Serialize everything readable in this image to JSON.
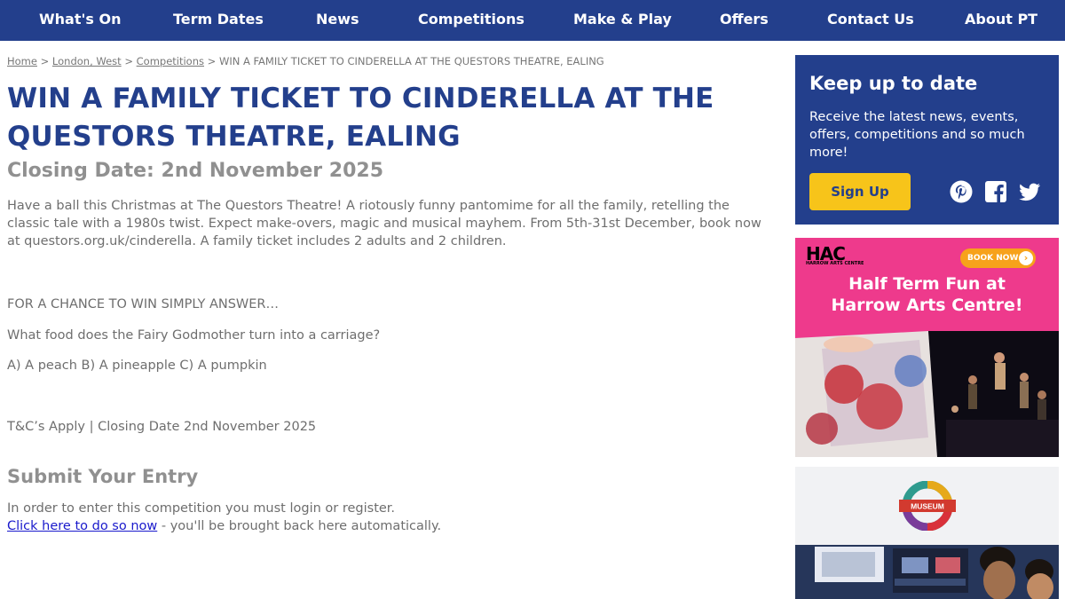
{
  "nav": {
    "items": [
      "What's On",
      "Term Dates",
      "News",
      "Competitions",
      "Make & Play",
      "Offers",
      "Contact Us",
      "About PT"
    ]
  },
  "breadcrumb": {
    "home": "Home",
    "sep1": " > ",
    "region": "London, West",
    "sep2": " > ",
    "section": "Competitions",
    "sep3": " > ",
    "current": "WIN A FAMILY TICKET TO CINDERELLA AT THE QUESTORS THEATRE, EALING"
  },
  "article": {
    "title_line1": "WIN A FAMILY TICKET TO CINDERELLA AT THE",
    "title_line2": "QUESTORS THEATRE, EALING",
    "closing_date": "Closing Date: 2nd November 2025",
    "description": "Have a ball this Christmas at The Questors Theatre! A riotously funny pantomime for all the family, retelling the classic tale with a 1980s twist. Expect make-overs, magic and musical mayhem. From 5th-31st December, book now at questors.org.uk/cinderella. A family ticket includes 2 adults and 2 children.",
    "chance_text": "FOR A CHANCE TO WIN SIMPLY ANSWER…",
    "question": "What food does the Fairy Godmother turn into a carriage?",
    "options": "A) A peach B) A pineapple C) A pumpkin",
    "terms": "T&C’s Apply | Closing Date 2nd November 2025",
    "submit_title": "Submit Your Entry",
    "login_note": "In order to enter this competition you must login or register.",
    "login_link": "Click here to do so now",
    "login_suffix": " - you'll be brought back here automatically."
  },
  "newsletter": {
    "title": "Keep up to date",
    "text": "Receive the latest news, events, offers, competitions and so much more!",
    "signup_label": "Sign Up",
    "icons": [
      "pinterest-icon",
      "facebook-icon",
      "twitter-icon"
    ]
  },
  "ad_hac": {
    "logo": "HAC",
    "logo_sub": "HARROW ARTS CENTRE",
    "book_now": "BOOK NOW",
    "headline_line1": "Half Term Fun at",
    "headline_line2": "Harrow Arts Centre!"
  },
  "ad_museum": {
    "roundel_text": "MUSEUM"
  },
  "colors": {
    "brand_blue": "#233f8c",
    "accent_yellow": "#f7c41a",
    "hac_pink": "#ee3a8c"
  }
}
